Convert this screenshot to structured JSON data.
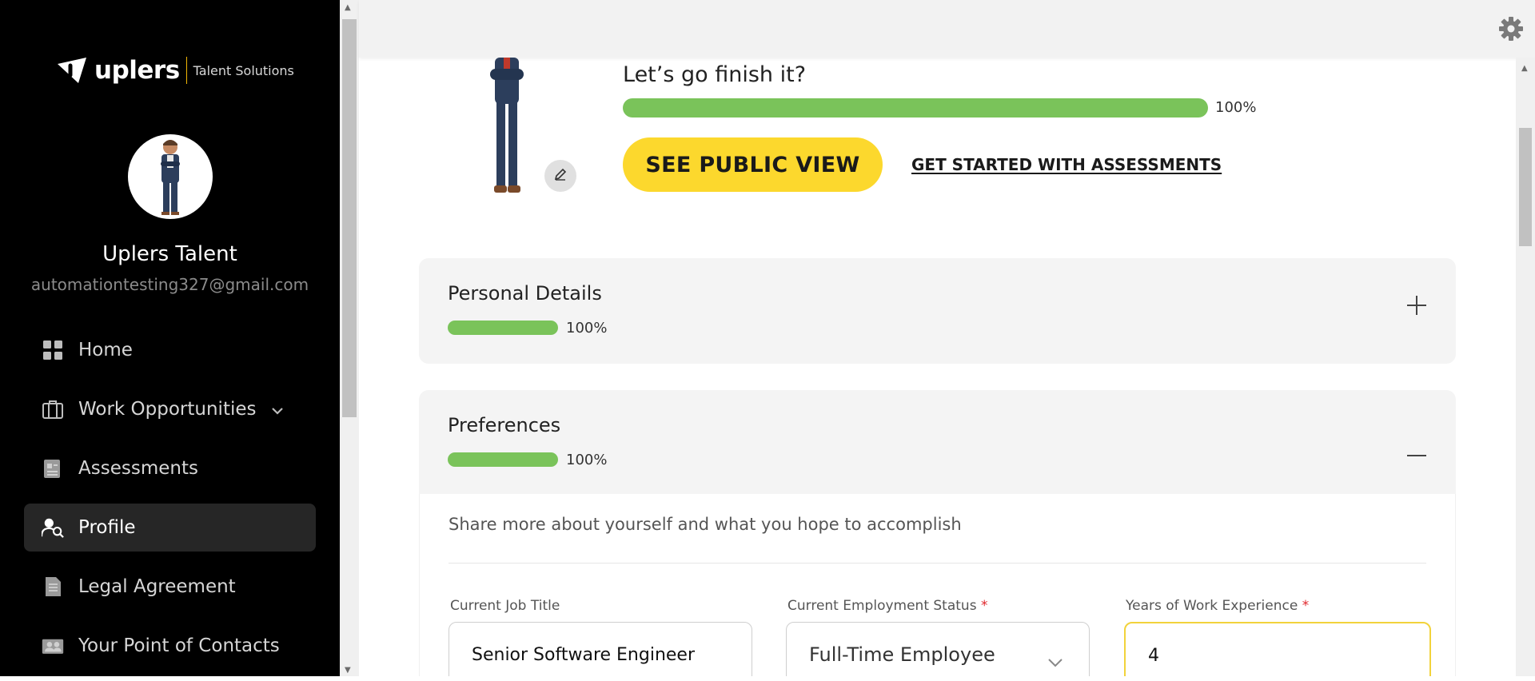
{
  "brand": {
    "name": "uplers",
    "tagline": "Talent Solutions",
    "accent": "#FCD82D"
  },
  "user": {
    "name": "Uplers Talent",
    "email": "automationtesting327@gmail.com"
  },
  "nav": {
    "items": [
      {
        "label": "Home",
        "icon": "grid-icon",
        "active": false
      },
      {
        "label": "Work Opportunities",
        "icon": "briefcase-icon",
        "active": false,
        "has_submenu": true
      },
      {
        "label": "Assessments",
        "icon": "assessment-icon",
        "active": false
      },
      {
        "label": "Profile",
        "icon": "profile-search-icon",
        "active": true
      },
      {
        "label": "Legal Agreement",
        "icon": "document-icon",
        "active": false
      },
      {
        "label": "Your Point of Contacts",
        "icon": "contacts-icon",
        "active": false
      }
    ]
  },
  "header": {
    "settings_icon": "gear-icon"
  },
  "completion": {
    "title": "Let’s go finish it?",
    "percent_label": "100%",
    "progress": 1.0,
    "public_view_button": "SEE PUBLIC VIEW",
    "assessments_link": "GET STARTED WITH ASSESSMENTS"
  },
  "sections": {
    "personal": {
      "title": "Personal Details",
      "percent_label": "100%",
      "progress": 1.0,
      "toggle": "+"
    },
    "preferences": {
      "title": "Preferences",
      "percent_label": "100%",
      "progress": 1.0,
      "toggle": "—"
    }
  },
  "preferences_form": {
    "intro": "Share more about yourself and what you hope to accomplish",
    "job_title_label": "Current Job Title",
    "job_title_value": "Senior Software Engineer",
    "employment_label": "Current Employment Status",
    "employment_value": "Full-Time Employee",
    "experience_label": "Years of Work Experience",
    "experience_value": "4",
    "required_mark": "*"
  },
  "colors": {
    "progress_green": "#7AC35A",
    "sidebar_bg": "#000000",
    "required_red": "#E0262B"
  }
}
